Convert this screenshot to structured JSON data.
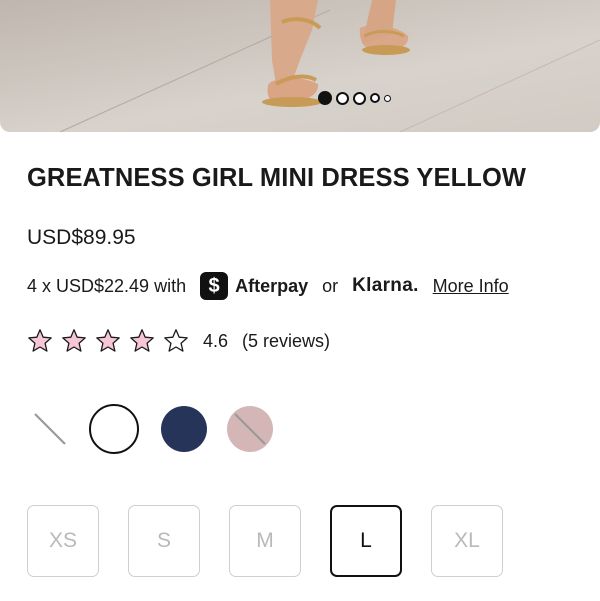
{
  "gallery": {
    "slide_count": 5,
    "active_index": 0
  },
  "product": {
    "title": "GREATNESS GIRL MINI DRESS YELLOW",
    "price": "USD$89.95"
  },
  "payment": {
    "installments_text": "4 x USD$22.49 with",
    "afterpay_icon": "$",
    "afterpay_label": "Afterpay",
    "or_text": "or",
    "klarna_label": "Klarna.",
    "more_info_label": "More Info"
  },
  "rating": {
    "stars_total": 5,
    "value": "4.6",
    "count_text": "(5 reviews)",
    "star_color": "#f6c6d6"
  },
  "colors": {
    "swatches": [
      {
        "name": "unavailable-white",
        "color": "#ffffff",
        "available": false
      },
      {
        "name": "white",
        "color": "#ffffff",
        "available": true,
        "selected": true
      },
      {
        "name": "navy",
        "color": "#27345a",
        "available": true
      },
      {
        "name": "blush",
        "color": "#d4b6b7",
        "available": false
      }
    ]
  },
  "sizes": {
    "options": [
      "XS",
      "S",
      "M",
      "L",
      "XL"
    ],
    "selected": "L"
  }
}
